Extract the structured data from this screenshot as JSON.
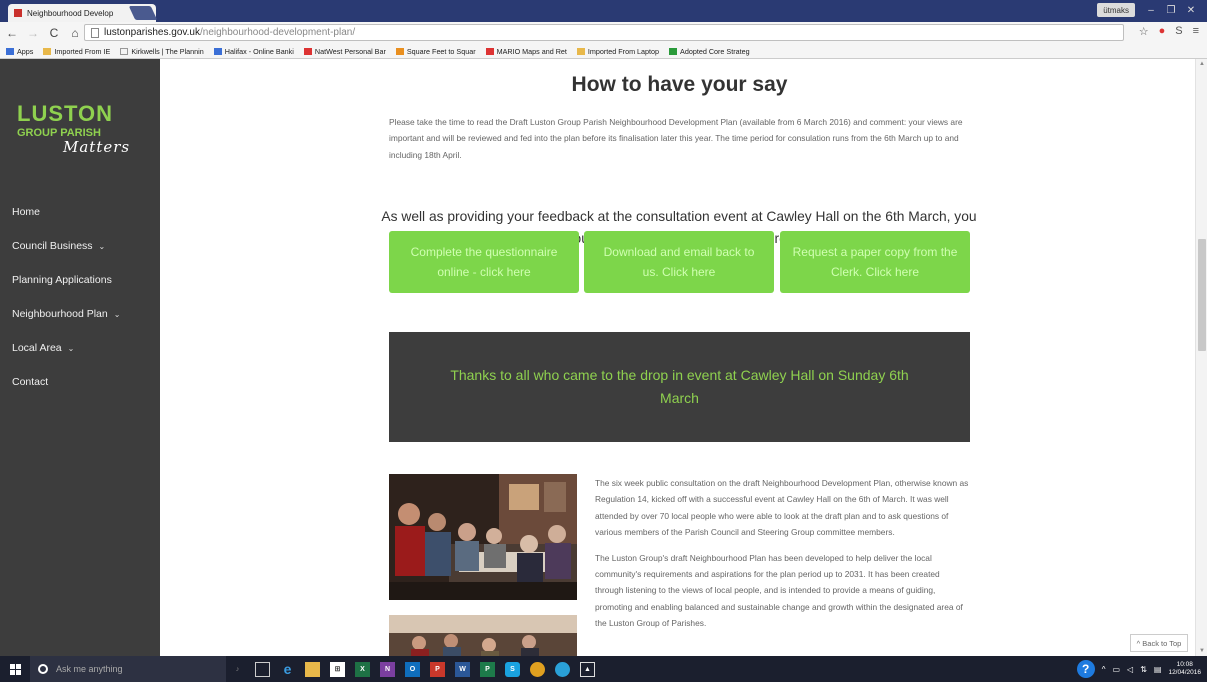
{
  "browser": {
    "tab_title": "Neighbourhood Develop",
    "tab_close": "×",
    "user_label": "ütmaks",
    "url_host": "lustonparishes.gov.uk",
    "url_path": "/neighbourhood-development-plan/",
    "bookmarks": [
      "Apps",
      "Imported From IE",
      "Kirkwells | The Plannin",
      "Halifax - Online Banki",
      "NatWest Personal Bar",
      "Square Feet to Squar",
      "MARIO Maps and Ret",
      "Imported From Laptop",
      "Adopted Core Strateg"
    ]
  },
  "site": {
    "logo_main": "LUSTON",
    "logo_sub": "GROUP PARISH",
    "logo_script": "Matters",
    "menu": [
      {
        "label": "Home",
        "dropdown": ""
      },
      {
        "label": "Council Business",
        "dropdown": "⌄"
      },
      {
        "label": "Planning Applications",
        "dropdown": ""
      },
      {
        "label": "Neighbourhood Plan",
        "dropdown": "⌄"
      },
      {
        "label": "Local Area",
        "dropdown": "⌄"
      },
      {
        "label": "Contact",
        "dropdown": ""
      }
    ]
  },
  "content": {
    "title": "How to have your say",
    "intro": "Please take the time to read the Draft Luston Group Parish Neighbourhood Development Plan (available from 6 March 2016) and comment: your views are important and will be reviewed and fed into the plan before its finalisation later this year. The time period for consulation runs from the 6th March up to and including 18th April.",
    "lead": "As well as providing your feedback at the consultation event at Cawley Hall on the 6th March, you can provide your feedback on a questionnaire response form.",
    "buttons": [
      "Complete the questionnaire online - click here",
      "Download and email back to us. Click here",
      "Request a paper copy from the Clerk. Click here"
    ],
    "banner": "Thanks to all who came to the drop in event at Cawley Hall on Sunday 6th March",
    "para1": "The six week public consultation on the draft Neighbourhood Development Plan, otherwise known as Regulation 14, kicked off with a successful event at Cawley Hall on the 6th of March. It was well attended by over 70 local people who were able to look at the draft plan and to ask questions of various members of the Parish Council and Steering Group committee members.",
    "para2": "The Luston Group's draft Neighbourhood Plan has been developed to help deliver the local community's requirements and aspirations for the plan period up to 2031. It has been created through listening to the views of local people, and is intended to provide a means of guiding, promoting and enabling balanced and sustainable change and growth within the designated area of the Luston Group of Parishes.",
    "back_to_top": "^ Back to Top"
  },
  "taskbar": {
    "search_placeholder": "Ask me anything",
    "time": "10:08",
    "date": "12/04/2016"
  },
  "colors": {
    "brand_green": "#8fd14f",
    "button_green": "#7dd64a",
    "sidebar_dark": "#3d3d3d"
  }
}
